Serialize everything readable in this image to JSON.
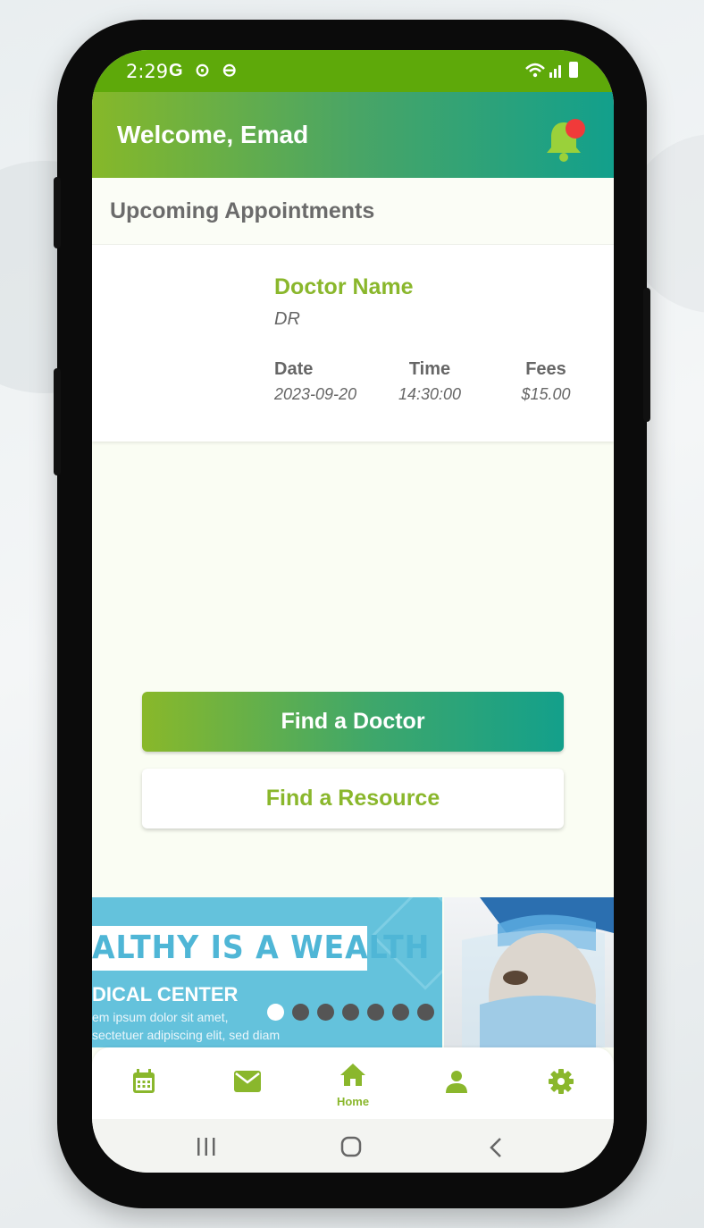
{
  "status_bar": {
    "time": "2:29",
    "left_icons": "G ⊙ ⊖",
    "right_icons": "📶"
  },
  "header": {
    "title": "Welcome, Emad"
  },
  "section": {
    "title": "Upcoming Appointments"
  },
  "appointment": {
    "doctor_name": "Doctor Name",
    "doctor_title": "DR",
    "date_label": "Date",
    "date_value": "2023-09-20",
    "time_label": "Time",
    "time_value": "14:30:00",
    "fees_label": "Fees",
    "fees_value": "$15.00"
  },
  "actions": {
    "find_doctor": "Find a Doctor",
    "find_resource": "Find a Resource"
  },
  "carousel": {
    "banner_text": "ALTHY IS A WEALTH",
    "sub_text": "DICAL CENTER",
    "line1": "em ipsum dolor sit amet,",
    "line2": "sectetuer adipiscing elit, sed diam",
    "slide_count": 7,
    "active_index": 0
  },
  "bottom_nav": {
    "items": [
      {
        "icon": "calendar-icon"
      },
      {
        "icon": "mail-icon"
      },
      {
        "icon": "home-icon",
        "label": "Home"
      },
      {
        "icon": "person-icon"
      },
      {
        "icon": "gear-icon"
      }
    ]
  },
  "colors": {
    "brand_green": "#8ab72c",
    "brand_teal": "#12a08c",
    "status_green": "#5ea90a",
    "notification_red": "#f03a3a"
  }
}
